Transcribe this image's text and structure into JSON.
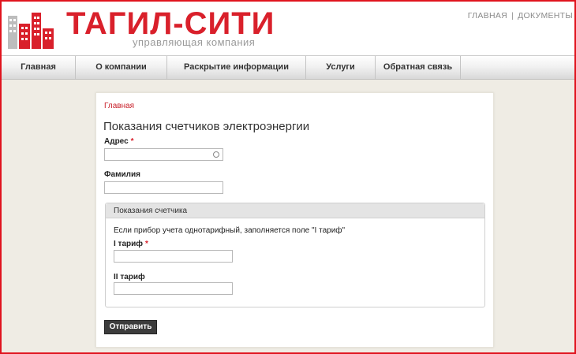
{
  "header": {
    "logo_title": "ТАГИЛ-СИТИ",
    "logo_subtitle": "управляющая компания",
    "top_links": [
      "ГЛАВНАЯ",
      "ДОКУМЕНТЫ"
    ],
    "top_link_separator": "|"
  },
  "nav": {
    "items": [
      {
        "label": "Главная"
      },
      {
        "label": "О компании"
      },
      {
        "label": "Раскрытие информации"
      },
      {
        "label": "Услуги"
      },
      {
        "label": "Обратная связь"
      }
    ]
  },
  "page": {
    "breadcrumb": "Главная",
    "title": "Показания счетчиков электроэнергии"
  },
  "form": {
    "address_label": "Адрес",
    "required_mark": "*",
    "address_value": "",
    "surname_label": "Фамилия",
    "surname_value": "",
    "fieldset_legend": "Показания счетчика",
    "hint": "Если прибор учета однотарифный, заполняется поле \"I тариф\"",
    "tariff1_label": "I тариф",
    "tariff1_value": "",
    "tariff2_label": "II тариф",
    "tariff2_value": "",
    "submit_label": "Отправить"
  },
  "colors": {
    "brand_red": "#d9202b",
    "frame_red": "#e0141e",
    "background": "#efece4",
    "button_dark": "#3c3c3c"
  }
}
